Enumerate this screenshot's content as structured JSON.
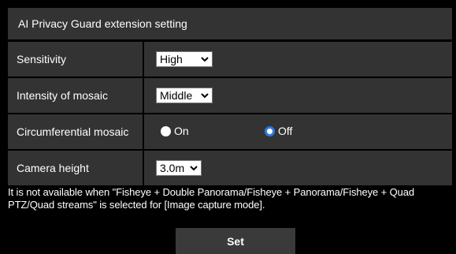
{
  "section_title": "AI Privacy Guard extension setting",
  "rows": [
    {
      "label": "Sensitivity",
      "value": "High"
    },
    {
      "label": "Intensity of mosaic",
      "value": "Middle"
    },
    {
      "label": "Circumferential mosaic",
      "options": [
        "On",
        "Off"
      ],
      "selected": "Off"
    },
    {
      "label": "Camera height",
      "value": "3.0m"
    }
  ],
  "note": "It is not available when \"Fisheye + Double Panorama/Fisheye + Panorama/Fisheye + Quad PTZ/Quad streams\" is selected for [Image capture mode].",
  "set_label": "Set",
  "colors": {
    "cell_bg": "#333333",
    "accent": "#2b7be4"
  }
}
